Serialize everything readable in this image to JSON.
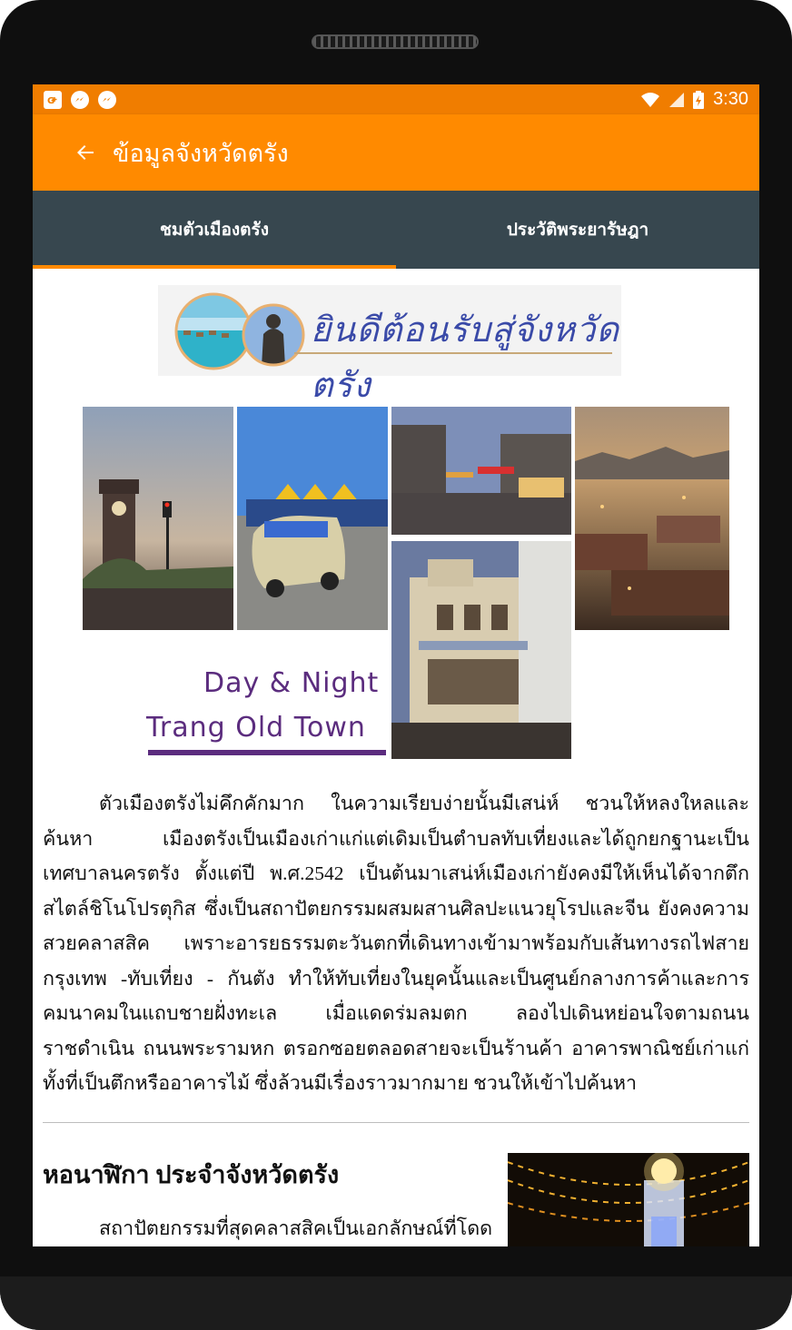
{
  "status_bar": {
    "time": "3:30",
    "notifications": [
      "gplus-icon",
      "messenger-icon",
      "messenger-icon"
    ],
    "indicators": [
      "wifi-icon",
      "signal-icon",
      "battery-charging-icon"
    ]
  },
  "app_bar": {
    "title": "ข้อมูลจังหวัดตรัง",
    "back_icon": "arrow-back-icon"
  },
  "tabs": [
    {
      "label": "ชมตัวเมืองตรัง",
      "active": true
    },
    {
      "label": "ประวัติพระยารัษฎา",
      "active": false
    }
  ],
  "banner": {
    "text": "ยินดีต้อนรับสู่จังหวัดตรัง"
  },
  "collage": {
    "line1": "Day & Night",
    "line2": "Trang Old Town"
  },
  "article": {
    "body": "ตัวเมืองตรังไม่คึกคักมาก ในความเรียบง่ายนั้นมีเสน่ห์ ชวนให้หลงใหลและค้นหา เมืองตรังเป็นเมืองเก่าแก่แต่เดิมเป็นตำบลทับเที่ยงและได้ถูกยกฐานะเป็นเทศบาลนครตรัง ตั้งแต่ปี พ.ศ.2542 เป็นต้นมาเสน่ห์เมืองเก่ายังคงมีให้เห็นได้จากตึกสไตล์ชิโนโปรตุกิส ซึ่งเป็นสถาปัตยกรรมผสมผสานศิลปะแนวยุโรปและจีน ยังคงความสวยคลาสสิค เพราะอารยธรรมตะวันตกที่เดินทางเข้ามาพร้อมกับเส้นทางรถไฟสายกรุงเทพ -ทับเที่ยง - กันตัง ทำให้ทับเที่ยงในยุคนั้นและเป็นศูนย์กลางการค้าและการคมนาคมในแถบชายฝั่งทะเล เมื่อแดดร่มลมตก ลองไปเดินหย่อนใจตามถนนราชดำเนิน ถนนพระรามหก ตรอกซอยตลอดสายจะเป็นร้านค้า อาคารพาณิชย์เก่าแก่ ทั้งที่เป็นตึกหรืออาคารไม้ ซึ่งล้วนมีเรื่องราวมากมาย ชวนให้เข้าไปค้นหา"
  },
  "section": {
    "title": "หอนาฬิกา ประจำจังหวัดตรัง",
    "text": "สถาปัตยกรรมที่สุดคลาสสิคเป็นเอกลักษณ์ที่โดด"
  },
  "colors": {
    "status_bar": "#f07d00",
    "app_bar": "#ff8a00",
    "tab_bar": "#37474f",
    "tab_indicator": "#ff8a00",
    "collage_text": "#5b2c7e"
  }
}
